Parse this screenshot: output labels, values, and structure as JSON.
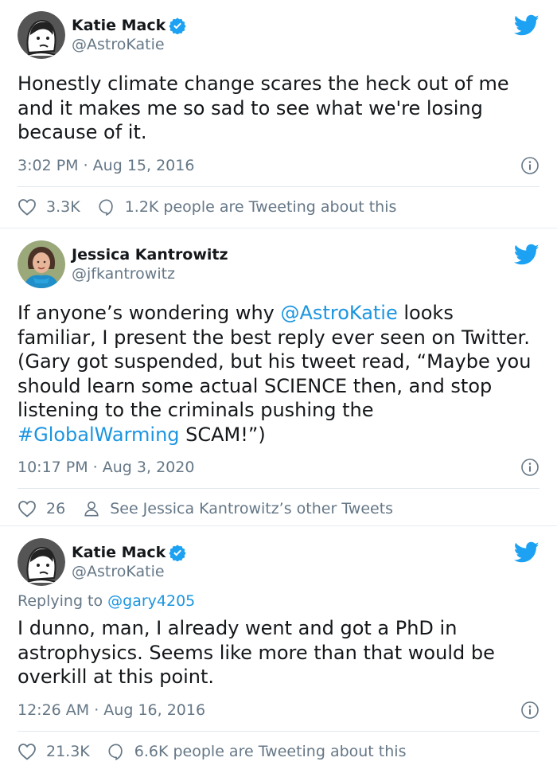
{
  "colors": {
    "accent": "#1da1f2",
    "link": "#1b95e0",
    "muted": "#657786",
    "text": "#14171a"
  },
  "tweets": [
    {
      "display_name": "Katie Mack",
      "handle": "@AstroKatie",
      "verified": true,
      "body": "Honestly climate change scares the heck out of me\nand it makes me so sad to see what we're losing\nbecause of it.",
      "timestamp": "3:02 PM · Aug 15, 2016",
      "likes": "3.3K",
      "secondary_action": "1.2K people are Tweeting about this",
      "secondary_icon": "speech-bubble-icon"
    },
    {
      "display_name": "Jessica Kantrowitz",
      "handle": "@jfkantrowitz",
      "verified": false,
      "body_parts": {
        "p1": "If anyone’s wondering why ",
        "mention": "@AstroKatie",
        "p2": " looks\nfamiliar, I present the best reply ever seen on Twitter.\n(Gary got suspended, but his tweet read, “Maybe you\nshould learn some actual SCIENCE then, and stop\nlistening to the criminals pushing the\n",
        "hashtag": "#GlobalWarming",
        "p3": " SCAM!”)"
      },
      "timestamp": "10:17 PM · Aug 3, 2020",
      "likes": "26",
      "secondary_action": "See Jessica Kantrowitz’s other Tweets",
      "secondary_icon": "person-icon"
    },
    {
      "display_name": "Katie Mack",
      "handle": "@AstroKatie",
      "verified": true,
      "replying_to_prefix": "Replying to ",
      "replying_to_handle": "@gary4205",
      "body": "I dunno, man, I already went and got a PhD in\nastrophysics. Seems like more than that would be\noverkill at this point.",
      "timestamp": "12:26 AM · Aug 16, 2016",
      "likes": "21.3K",
      "secondary_action": "6.6K people are Tweeting about this",
      "secondary_icon": "speech-bubble-icon"
    }
  ]
}
